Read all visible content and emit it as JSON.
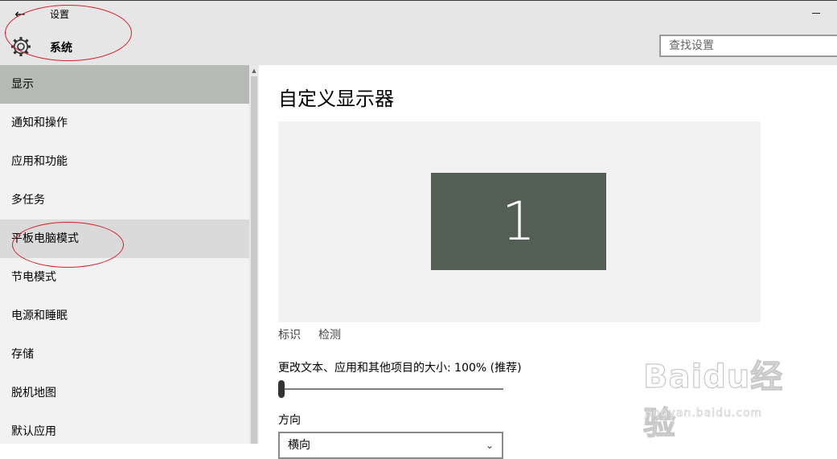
{
  "window": {
    "title": "设置",
    "back_glyph": "←"
  },
  "header": {
    "category_title": "系统",
    "search_placeholder": "查找设置"
  },
  "sidebar": {
    "items": [
      {
        "label": "显示",
        "state": "selected"
      },
      {
        "label": "通知和操作"
      },
      {
        "label": "应用和功能"
      },
      {
        "label": "多任务"
      },
      {
        "label": "平板电脑模式",
        "state": "hover"
      },
      {
        "label": "节电模式"
      },
      {
        "label": "电源和睡眠"
      },
      {
        "label": "存储"
      },
      {
        "label": "脱机地图"
      },
      {
        "label": "默认应用"
      }
    ]
  },
  "main": {
    "title": "自定义显示器",
    "monitor_number": "1",
    "identify_label": "标识",
    "detect_label": "检测",
    "scale_label": "更改文本、应用和其他项目的大小: 100% (推荐)",
    "scale_slider_fraction": 0.0,
    "orientation_label": "方向",
    "orientation_value": "横向"
  },
  "watermark": {
    "brand": "Baidu经验",
    "url": "jingyan.baidu.com"
  },
  "colors": {
    "selected_nav": "#b7bbb6",
    "hover_nav": "#dadada",
    "monitor_tile": "#535f55",
    "annotation": "#d5202a"
  },
  "icons": {
    "back": "back-arrow-icon",
    "settings": "gear-icon",
    "minimize": "minimize-icon",
    "dropdown": "chevron-down-icon"
  }
}
